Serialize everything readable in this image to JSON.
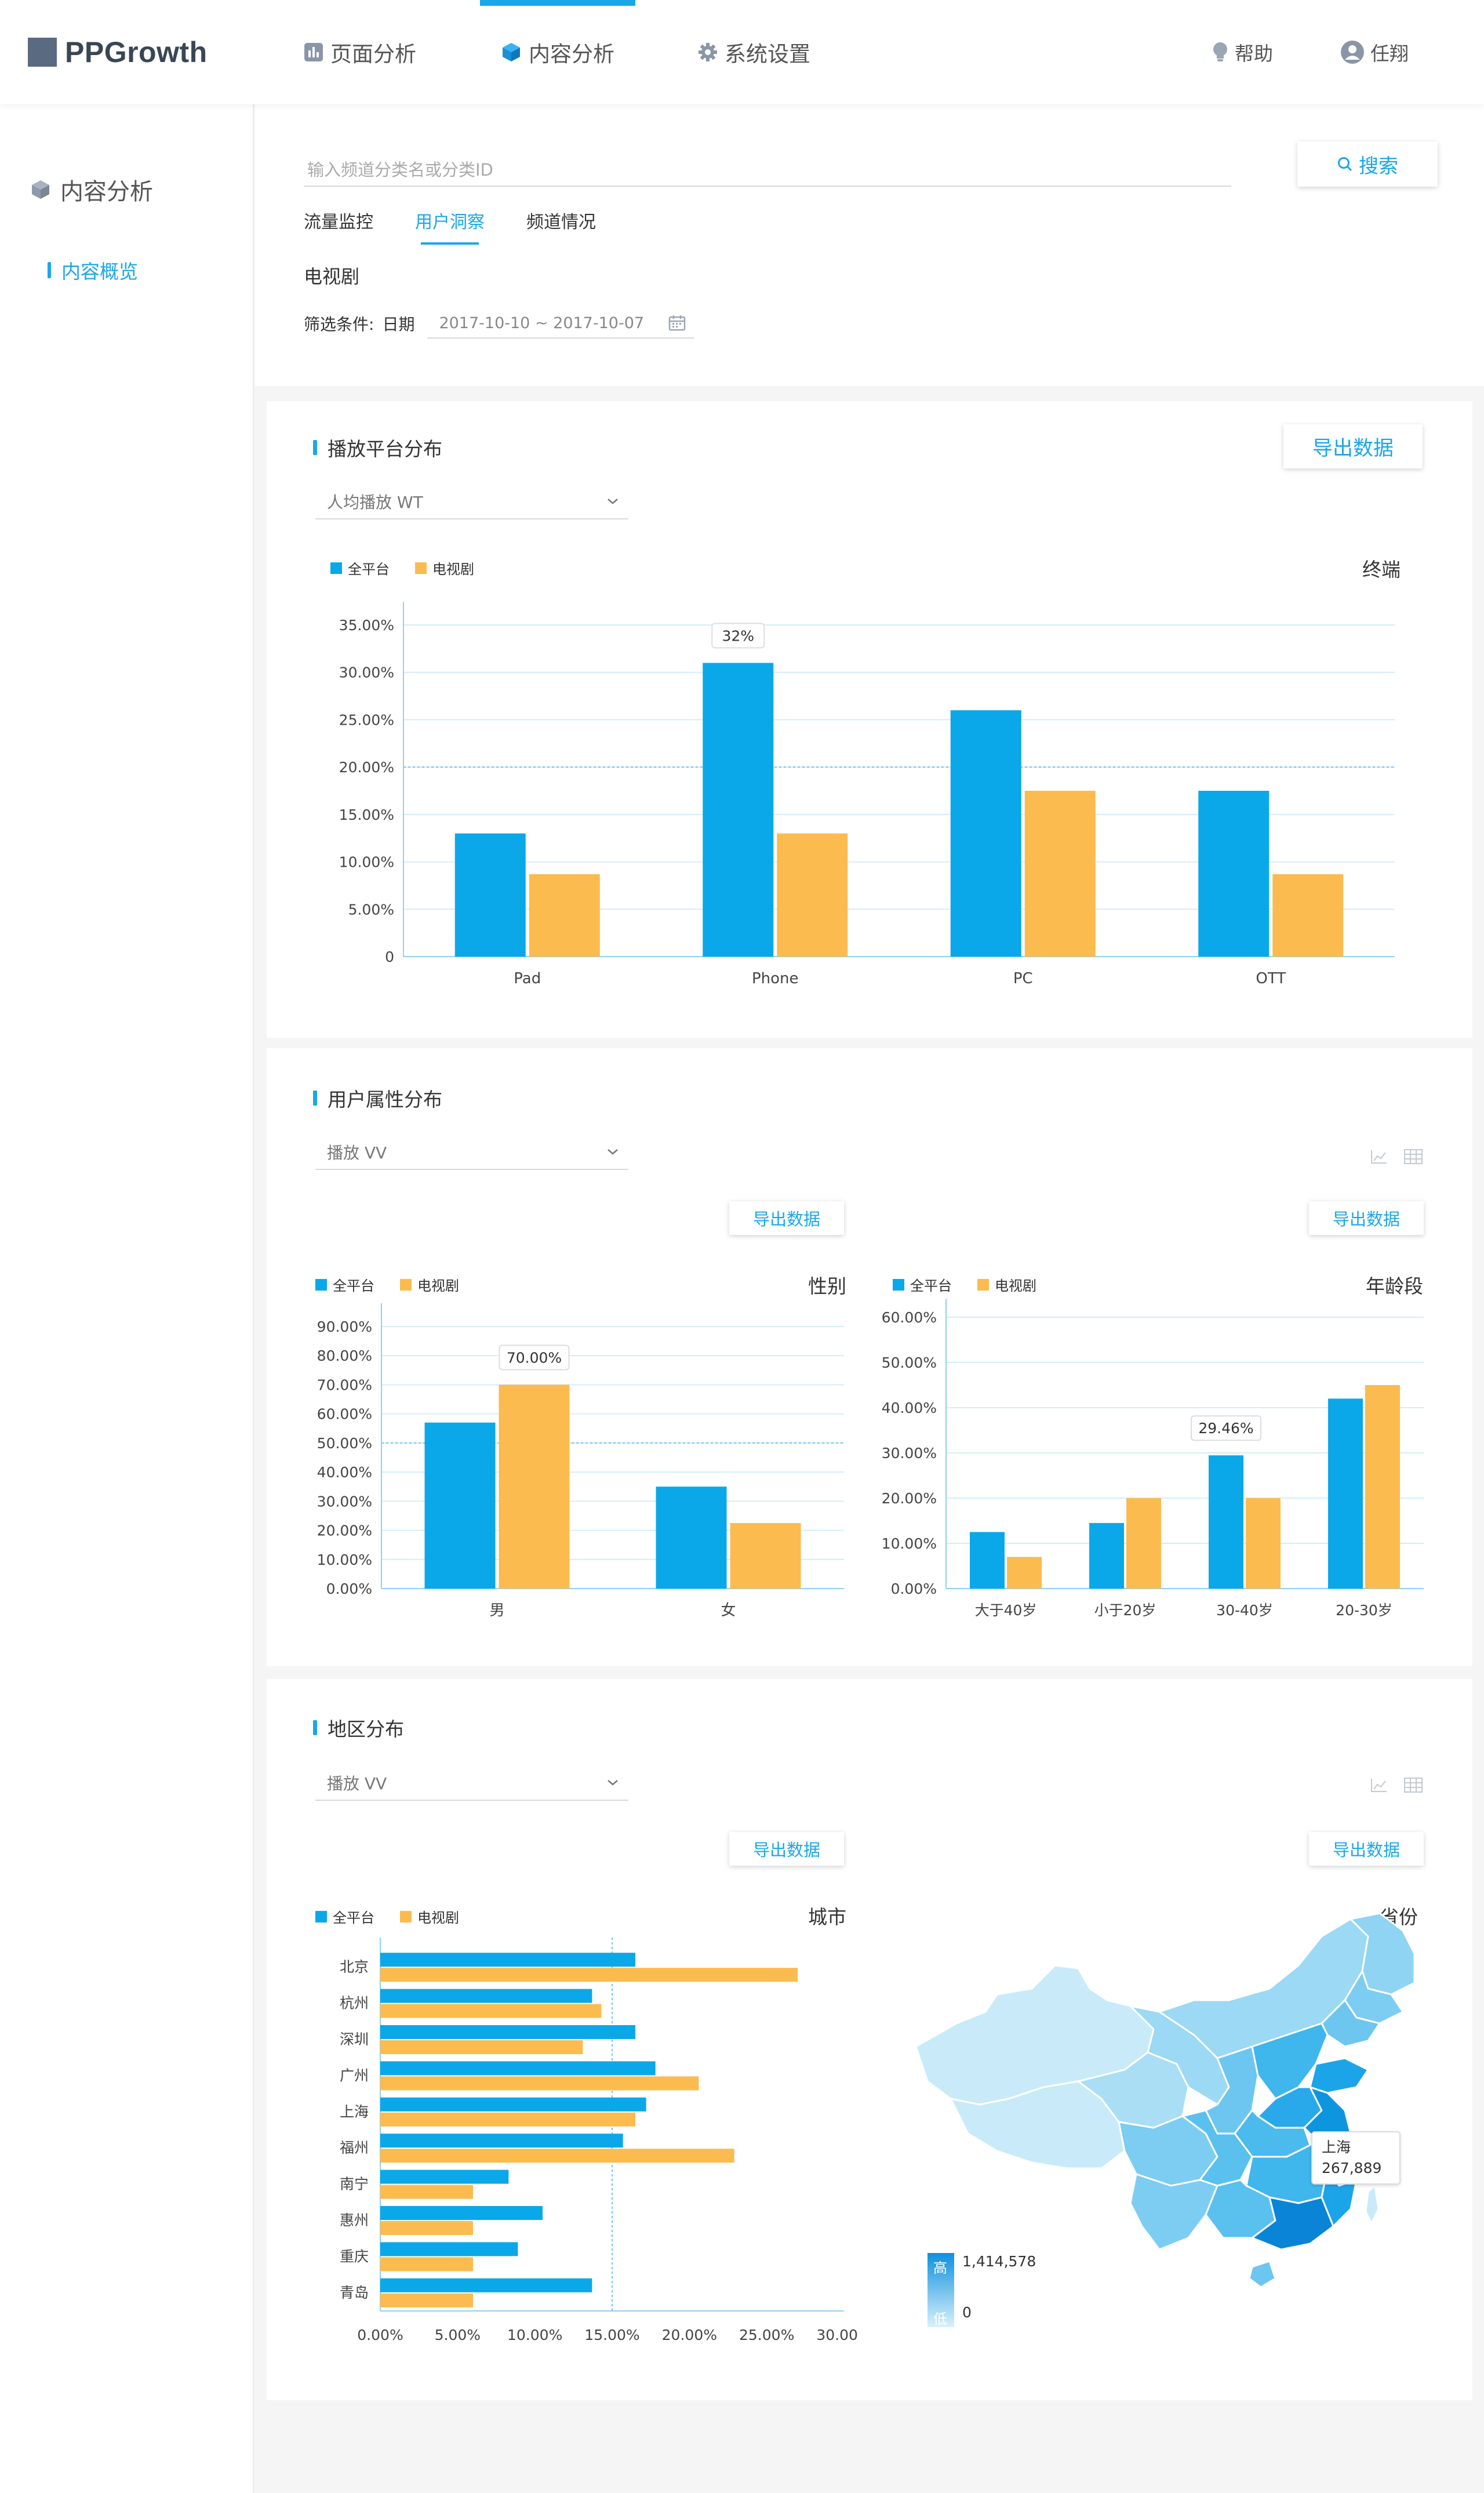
{
  "app": {
    "logo": "PPGrowth"
  },
  "nav": {
    "items": [
      {
        "label": "页面分析",
        "icon": "bar-chart-icon"
      },
      {
        "label": "内容分析",
        "icon": "cube-icon",
        "active": true
      },
      {
        "label": "系统设置",
        "icon": "gear-icon"
      }
    ],
    "help": "帮助",
    "user": "任翔"
  },
  "sidebar": {
    "title": "内容分析",
    "items": [
      {
        "label": "内容概览",
        "active": true
      }
    ]
  },
  "filter": {
    "search_placeholder": "输入频道分类名或分类ID",
    "search_button": "搜索",
    "tabs": [
      {
        "label": "流量监控"
      },
      {
        "label": "用户洞察",
        "active": true
      },
      {
        "label": "频道情况"
      }
    ],
    "section": "电视剧",
    "condition_label": "筛选条件:",
    "date_label": "日期",
    "date_range": "2017-10-10 ~ 2017-10-07"
  },
  "colors": {
    "accent": "#1aa7e8",
    "series_all": "#0aa8e9",
    "series_tv": "#fbbb4f"
  },
  "legend": {
    "all": "全平台",
    "tv": "电视剧"
  },
  "platform_card": {
    "title": "播放平台分布",
    "select": "人均播放 WT",
    "export": "导出数据",
    "subtitle": "终端",
    "tooltip": "32%"
  },
  "attr_card": {
    "title": "用户属性分布",
    "select": "播放 VV",
    "export": "导出数据",
    "gender_subtitle": "性别",
    "age_subtitle": "年龄段",
    "gender_tooltip": "70.00%",
    "age_tooltip": "29.46%"
  },
  "region_card": {
    "title": "地区分布",
    "select": "播放 VV",
    "export": "导出数据",
    "city_subtitle": "城市",
    "province_subtitle": "省份",
    "map_tooltip_name": "上海",
    "map_tooltip_value": "267,889",
    "scale_high": "高",
    "scale_low": "低",
    "scale_max": "1,414,578",
    "scale_min": "0"
  },
  "chart_data": [
    {
      "type": "bar",
      "categories": [
        "Pad",
        "Phone",
        "PC",
        "OTT"
      ],
      "series": [
        {
          "name": "全平台",
          "values": [
            13,
            31,
            26,
            17.5
          ]
        },
        {
          "name": "电视剧",
          "values": [
            8.7,
            13,
            17.5,
            8.7
          ]
        }
      ],
      "yticks": [
        "0",
        "5.00%",
        "10.00%",
        "15.00%",
        "20.00%",
        "25.00%",
        "30.00%",
        "35.00%"
      ],
      "ylim": [
        0,
        35
      ]
    },
    {
      "type": "bar",
      "categories": [
        "男",
        "女"
      ],
      "series": [
        {
          "name": "全平台",
          "values": [
            57,
            35
          ]
        },
        {
          "name": "电视剧",
          "values": [
            70,
            22.5
          ]
        }
      ],
      "yticks": [
        "0.00%",
        "10.00%",
        "20.00%",
        "30.00%",
        "40.00%",
        "50.00%",
        "60.00%",
        "70.00%",
        "80.00%",
        "90.00%"
      ],
      "ylim": [
        0,
        90
      ]
    },
    {
      "type": "bar",
      "categories": [
        "大于40岁",
        "小于20岁",
        "30-40岁",
        "20-30岁"
      ],
      "series": [
        {
          "name": "全平台",
          "values": [
            12.5,
            14.5,
            29.46,
            42
          ]
        },
        {
          "name": "电视剧",
          "values": [
            7,
            20,
            20,
            45
          ]
        }
      ],
      "yticks": [
        "0.00%",
        "10.00%",
        "20.00%",
        "30.00%",
        "40.00%",
        "50.00%",
        "60.00%"
      ],
      "ylim": [
        0,
        60
      ]
    },
    {
      "type": "bar",
      "orientation": "horizontal",
      "categories": [
        "北京",
        "杭州",
        "深圳",
        "广州",
        "上海",
        "福州",
        "南宁",
        "惠州",
        "重庆",
        "青岛"
      ],
      "series": [
        {
          "name": "全平台",
          "values": [
            16.5,
            13.7,
            16.5,
            17.8,
            17.2,
            15.7,
            8.3,
            10.5,
            8.9,
            13.7
          ]
        },
        {
          "name": "电视剧",
          "values": [
            27,
            14.3,
            13.1,
            20.6,
            16.5,
            22.9,
            6,
            6,
            6,
            6
          ]
        }
      ],
      "xticks": [
        "0.00%",
        "5.00%",
        "10.00%",
        "15.00%",
        "20.00%",
        "25.00%",
        "30.00%"
      ],
      "xlim": [
        0,
        30
      ]
    }
  ]
}
